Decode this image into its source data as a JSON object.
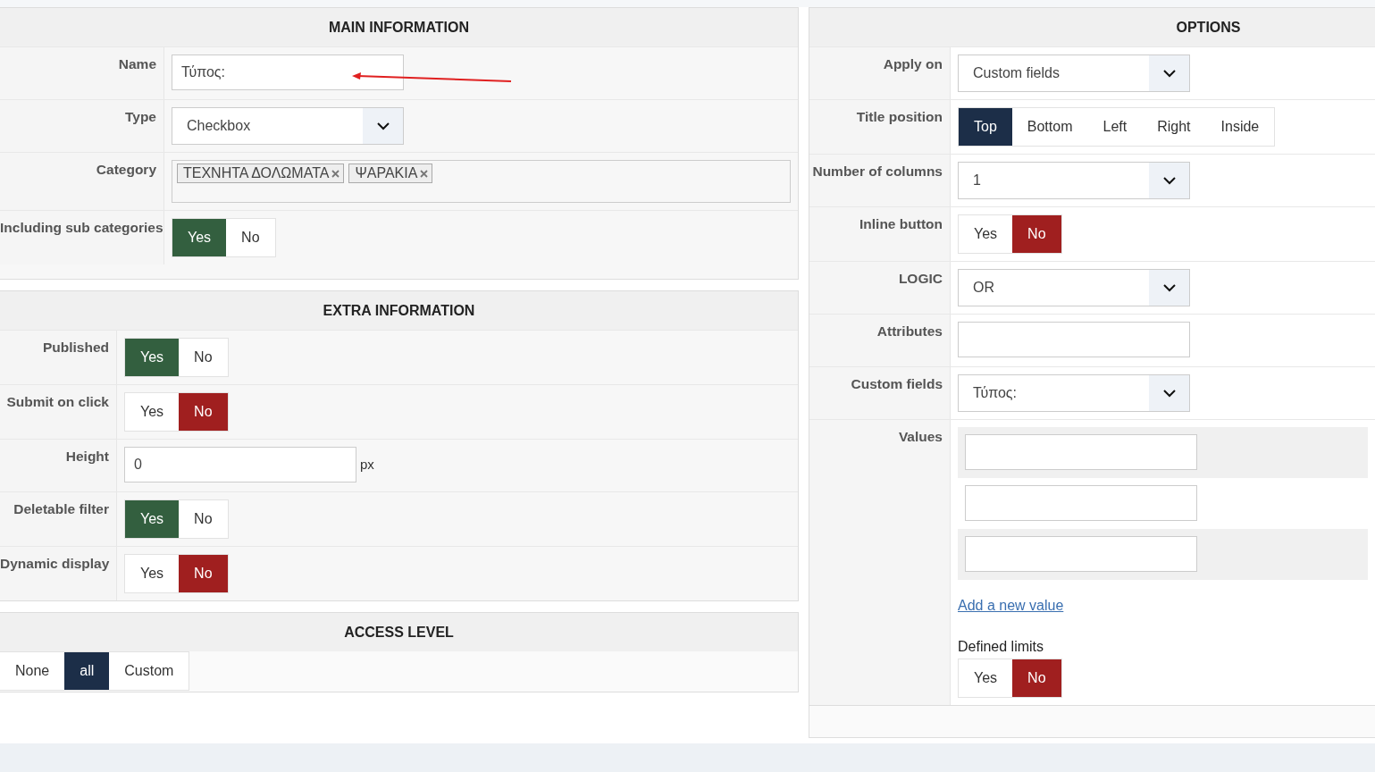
{
  "main_information": {
    "title": "MAIN INFORMATION",
    "rows": [
      {
        "label": "Name",
        "kind": "text",
        "value": "Τύπος:",
        "annotated": true
      },
      {
        "label": "Type",
        "kind": "select",
        "value": "Checkbox"
      },
      {
        "label": "Category",
        "kind": "tags",
        "tags": [
          "ΤΕΧΝΗΤΑ ΔΟΛΩΜΑΤΑ",
          "ΨΑΡΑΚΙΑ"
        ]
      },
      {
        "label": "Including sub categories",
        "kind": "yesno",
        "options": [
          {
            "label": "Yes",
            "selected": true
          },
          {
            "label": "No",
            "selected": false
          }
        ]
      }
    ]
  },
  "extra_information": {
    "title": "EXTRA INFORMATION",
    "rows": [
      {
        "label": "Published",
        "kind": "yesno",
        "options": [
          {
            "label": "Yes",
            "selected": true
          },
          {
            "label": "No",
            "selected": false
          }
        ]
      },
      {
        "label": "Submit on click",
        "kind": "yesno",
        "options": [
          {
            "label": "Yes",
            "selected": false
          },
          {
            "label": "No",
            "selected": true
          }
        ]
      },
      {
        "label": "Height",
        "kind": "unit",
        "value": "0",
        "unit": "px"
      },
      {
        "label": "Deletable filter",
        "kind": "yesno",
        "options": [
          {
            "label": "Yes",
            "selected": true
          },
          {
            "label": "No",
            "selected": false
          }
        ]
      },
      {
        "label": "Dynamic display",
        "kind": "yesno",
        "options": [
          {
            "label": "Yes",
            "selected": false
          },
          {
            "label": "No",
            "selected": true
          }
        ]
      }
    ]
  },
  "access_level": {
    "title": "ACCESS LEVEL",
    "options": [
      {
        "label": "None",
        "selected": false
      },
      {
        "label": "all",
        "selected": true
      },
      {
        "label": "Custom",
        "selected": false
      }
    ]
  },
  "options": {
    "title": "OPTIONS",
    "rows": [
      {
        "label": "Apply on",
        "kind": "select",
        "value": "Custom fields"
      },
      {
        "label": "Title position",
        "kind": "choice",
        "options": [
          {
            "label": "Top",
            "selected": true
          },
          {
            "label": "Bottom",
            "selected": false
          },
          {
            "label": "Left",
            "selected": false
          },
          {
            "label": "Right",
            "selected": false
          },
          {
            "label": "Inside",
            "selected": false
          }
        ]
      },
      {
        "label": "Number of columns",
        "kind": "select",
        "value": "1"
      },
      {
        "label": "Inline button",
        "kind": "yesno",
        "options": [
          {
            "label": "Yes",
            "selected": false
          },
          {
            "label": "No",
            "selected": true
          }
        ]
      },
      {
        "label": "LOGIC",
        "kind": "select",
        "value": "OR"
      },
      {
        "label": "Attributes",
        "kind": "text"
      },
      {
        "label": "Custom fields",
        "kind": "select",
        "value": "Τύπος:"
      },
      {
        "label": "Values",
        "kind": "values",
        "fields": [
          {
            "kind": "input"
          },
          {
            "kind": "input"
          },
          {
            "kind": "input"
          }
        ],
        "link": "Add a new value",
        "limits": {
          "label": "Defined limits",
          "options": [
            {
              "label": "Yes",
              "selected": false
            },
            {
              "label": "No",
              "selected": true
            }
          ]
        }
      }
    ]
  }
}
